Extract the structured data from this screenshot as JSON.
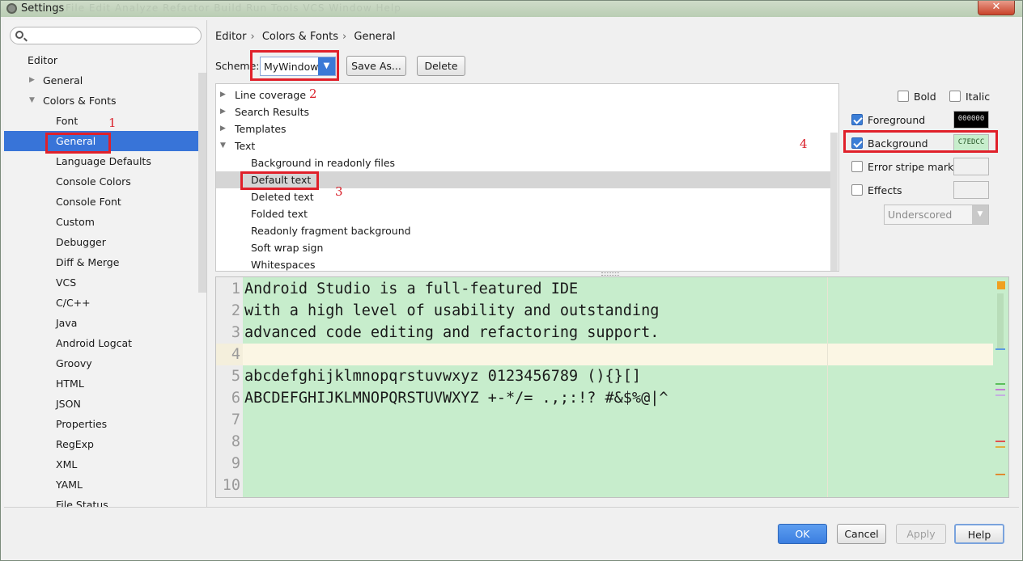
{
  "window": {
    "title": "Settings",
    "menu_ghost": "File  Edit  Analyze  Refactor  Build  Run  Tools  VCS  Window  Help",
    "close_glyph": "✕"
  },
  "search": {
    "value": "",
    "placeholder": ""
  },
  "sidebar": {
    "items": [
      {
        "label": "Editor"
      },
      {
        "label": "General"
      },
      {
        "label": "Colors & Fonts"
      },
      {
        "label": "Font"
      },
      {
        "label": "General"
      },
      {
        "label": "Language Defaults"
      },
      {
        "label": "Console Colors"
      },
      {
        "label": "Console Font"
      },
      {
        "label": "Custom"
      },
      {
        "label": "Debugger"
      },
      {
        "label": "Diff & Merge"
      },
      {
        "label": "VCS"
      },
      {
        "label": "C/C++"
      },
      {
        "label": "Java"
      },
      {
        "label": "Android Logcat"
      },
      {
        "label": "Groovy"
      },
      {
        "label": "HTML"
      },
      {
        "label": "JSON"
      },
      {
        "label": "Properties"
      },
      {
        "label": "RegExp"
      },
      {
        "label": "XML"
      },
      {
        "label": "YAML"
      },
      {
        "label": "File Status"
      }
    ]
  },
  "breadcrumb": [
    "Editor",
    "Colors & Fonts",
    "General"
  ],
  "scheme": {
    "label": "Scheme:",
    "selected": "MyWindow",
    "save_as": "Save As...",
    "delete": "Delete"
  },
  "elements": {
    "items": [
      {
        "label": "Line coverage"
      },
      {
        "label": "Search Results"
      },
      {
        "label": "Templates"
      },
      {
        "label": "Text"
      },
      {
        "label": "Background in readonly files"
      },
      {
        "label": "Default text"
      },
      {
        "label": "Deleted text"
      },
      {
        "label": "Folded text"
      },
      {
        "label": "Readonly fragment background"
      },
      {
        "label": "Soft wrap sign"
      },
      {
        "label": "Whitespaces"
      }
    ]
  },
  "attributes": {
    "bold": "Bold",
    "italic": "Italic",
    "foreground": "Foreground",
    "foreground_value": "000000",
    "background": "Background",
    "background_value": "C7EDCC",
    "error_stripe": "Error stripe mark",
    "effects": "Effects",
    "effects_type": "Underscored"
  },
  "annotations": [
    "1",
    "2",
    "3",
    "4"
  ],
  "preview": {
    "lines": [
      {
        "n": "1",
        "text": "Android Studio is a full-featured IDE"
      },
      {
        "n": "2",
        "text": "with a high level of usability and outstanding"
      },
      {
        "n": "3",
        "text": "advanced code editing and refactoring support."
      },
      {
        "n": "4",
        "text": ""
      },
      {
        "n": "5",
        "text": "abcdefghijklmnopqrstuvwxyz 0123456789 (){}[]"
      },
      {
        "n": "6",
        "text": "ABCDEFGHIJKLMNOPQRSTUVWXYZ +-*/= .,;:!? #&$%@|^"
      },
      {
        "n": "7",
        "text": ""
      },
      {
        "n": "8",
        "text": ""
      },
      {
        "n": "9",
        "text": ""
      },
      {
        "n": "10",
        "text": ""
      }
    ]
  },
  "buttons": {
    "ok": "OK",
    "cancel": "Cancel",
    "apply": "Apply",
    "help": "Help"
  },
  "colors": {
    "selection": "#3874d8",
    "annotation_red": "#e0202a",
    "editor_background": "#C7EDCC",
    "caret_row": "#fbf6e4"
  },
  "icons": {
    "search": "search-icon",
    "expanded": "triangle-down-icon",
    "collapsed": "triangle-right-icon",
    "dropdown": "chevron-down-icon"
  }
}
